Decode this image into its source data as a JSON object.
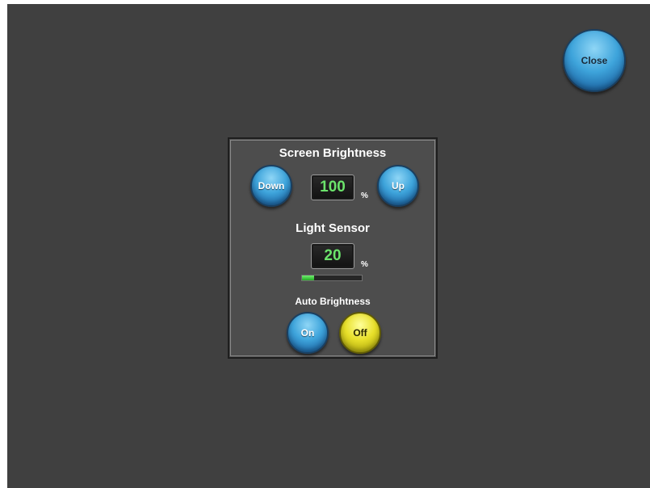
{
  "close_label": "Close",
  "brightness": {
    "title": "Screen Brightness",
    "down_label": "Down",
    "up_label": "Up",
    "value": "100",
    "unit": "%"
  },
  "sensor": {
    "title": "Light Sensor",
    "value": "20",
    "unit": "%",
    "level_percent": 20
  },
  "auto": {
    "title": "Auto Brightness",
    "on_label": "On",
    "off_label": "Off",
    "selected": "Off"
  },
  "colors": {
    "background": "#404040",
    "panel": "#4d4d4d",
    "readout_text": "#6be36b",
    "button_blue": "#3ea4db",
    "button_active_yellow": "#e8e02a"
  },
  "icons": {}
}
